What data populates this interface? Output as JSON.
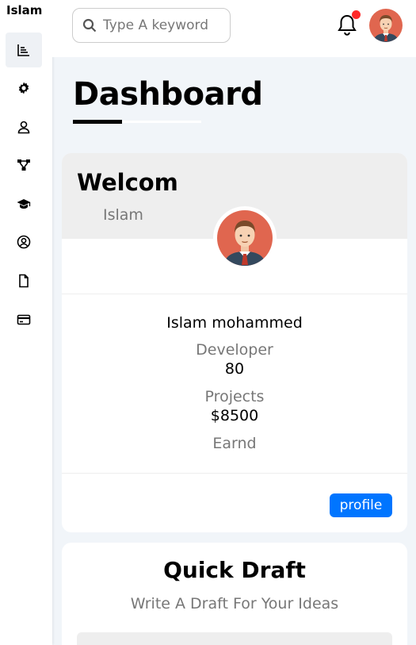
{
  "sidebar": {
    "brand": "Islam",
    "items": [
      {
        "icon": "chart-icon",
        "active": true
      },
      {
        "icon": "gear-icon"
      },
      {
        "icon": "user-icon"
      },
      {
        "icon": "nodes-icon"
      },
      {
        "icon": "graduation-cap-icon"
      },
      {
        "icon": "user-circle-icon"
      },
      {
        "icon": "file-icon"
      },
      {
        "icon": "credit-card-icon"
      }
    ]
  },
  "header": {
    "search_placeholder": "Type A keyword",
    "notification_dot_color": "#ff2a2a"
  },
  "main": {
    "title": "Dashboard"
  },
  "welcome": {
    "heading": "Welcom",
    "name": "Islam",
    "full_name": "Islam mohammed",
    "role_label": "Developer",
    "role_value": "80",
    "projects_label": "Projects",
    "projects_value": "$8500",
    "earned_label": "Earnd",
    "profile_button": "profile",
    "accent": "#0075ff"
  },
  "quick_draft": {
    "title": "Quick Draft",
    "subtitle": "Write A Draft For Your Ideas"
  }
}
